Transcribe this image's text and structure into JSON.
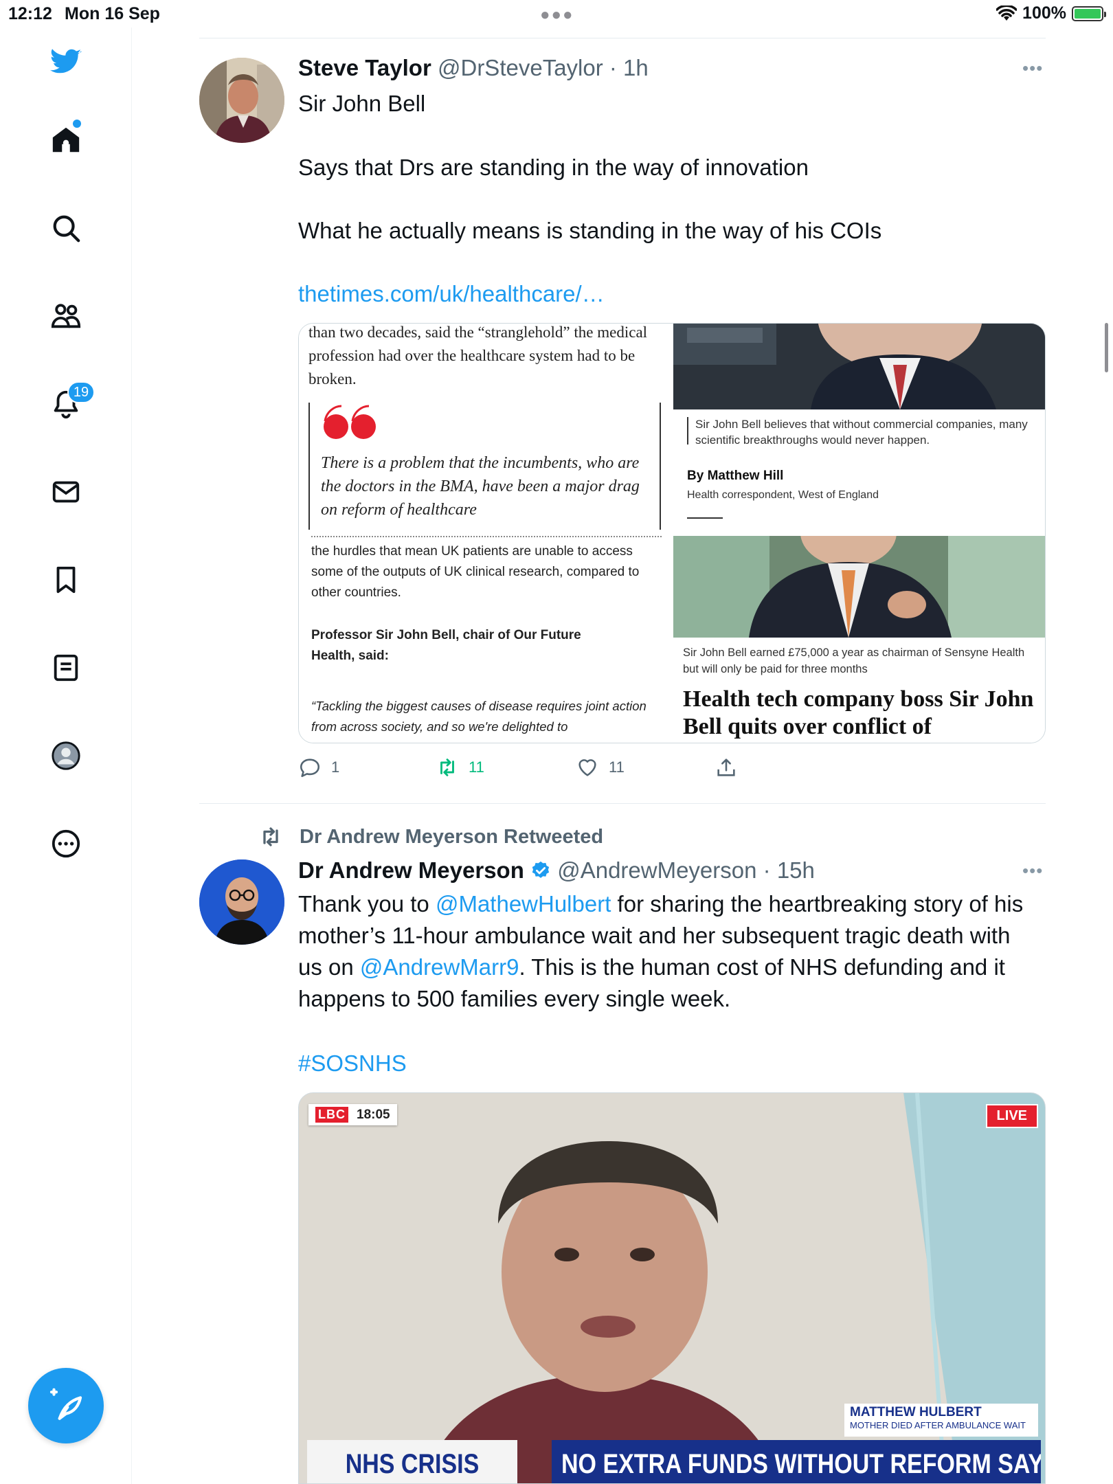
{
  "status_bar": {
    "time": "12:12",
    "date": "Mon 16 Sep",
    "battery": "100%"
  },
  "sidebar": {
    "notifications_badge": "19"
  },
  "tweets": [
    {
      "name": "Steve Taylor",
      "handle": "@DrSteveTaylor",
      "time": "· 1h",
      "text_lines": [
        "Sir John Bell",
        "Says that Drs are standing in the way of innovation",
        "What he actually means is standing in the way of his COIs"
      ],
      "link": "thetimes.com/uk/healthcare/…",
      "media": {
        "top_left_text": "than two decades, said the “stranglehold” the medical profession had over the healthcare system had to be broken.",
        "top_left_quote": "There is a problem that the incumbents, who are the doctors in the BMA, have been a major drag on reform of healthcare",
        "top_right_caption": "Sir John Bell believes that without commercial companies, many scientific breakthroughs would never happen.",
        "top_right_byline": "By Matthew Hill",
        "top_right_role": "Health correspondent, West of England",
        "bottom_left_para": "the hurdles that mean UK patients are unable to access some of the outputs of UK clinical research, compared to other countries.",
        "bottom_left_bold": "Professor Sir John Bell, chair of Our Future Health, said:",
        "bottom_left_quote": "“Tackling the biggest causes of disease requires joint action from across society, and so we're delighted to",
        "bottom_right_caption": "Sir John Bell earned £75,000 a year as chairman of Sensyne Health but will only be paid for three months",
        "bottom_right_headline": "Health tech company boss Sir John Bell quits over conflict of"
      },
      "replies": "1",
      "retweets": "11",
      "likes": "11"
    },
    {
      "retweeted_by": "Dr Andrew Meyerson Retweeted",
      "name": "Dr Andrew Meyerson",
      "handle": "@AndrewMeyerson",
      "time": "· 15h",
      "text_parts": {
        "a": "Thank you to ",
        "mention1": "@MathewHulbert",
        "b": " for sharing the heartbreaking story of his mother’s 11-hour ambulance wait and her subsequent tragic death with us on ",
        "mention2": "@AndrewMarr9",
        "c": ". This is the human cost of NHS defunding and it happens to 500 families every single week."
      },
      "hashtag": "#SOSNHS",
      "video": {
        "channel": "LBC",
        "clock": "18:05",
        "live": "LIVE",
        "name_strap": "MATTHEW HULBERT",
        "name_sub": "MOTHER DIED AFTER AMBULANCE WAIT",
        "lower_left": "NHS CRISIS",
        "lower_right": "NO EXTRA FUNDS WITHOUT REFORM SAYS PM"
      }
    }
  ],
  "colors": {
    "twitter_blue": "#1d9bf0",
    "retweet_green": "#00ba7c",
    "muted": "#536471"
  }
}
